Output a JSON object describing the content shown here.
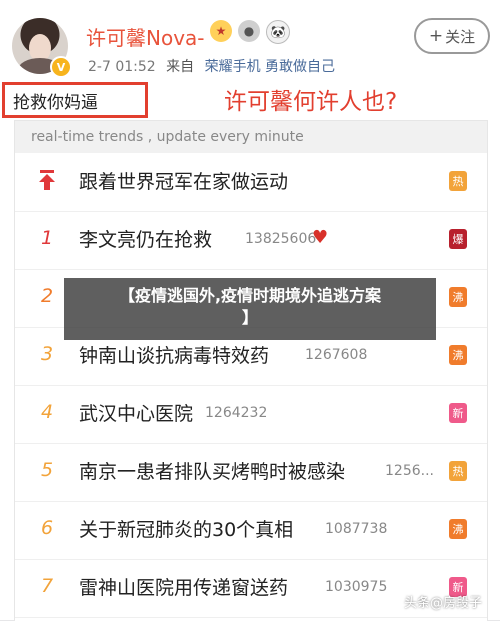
{
  "header": {
    "username": "许可馨Nova-",
    "verified_badge": "V",
    "badges": [
      {
        "icon": "medal-icon",
        "glyph": "★"
      },
      {
        "icon": "silver-medal-icon",
        "glyph": "●"
      },
      {
        "icon": "panda-icon",
        "glyph": "🐼"
      }
    ],
    "timestamp": "2-7 01:52",
    "from_label": "来自",
    "device": "荣耀手机 勇敢做自己",
    "follow_label": "关注",
    "follow_plus": "+"
  },
  "post": {
    "boxed_text": "抢救你妈逼",
    "headline": "许可馨何许人也?"
  },
  "trends": {
    "header": "real-time trends , update every minute",
    "items": [
      {
        "rank": "",
        "rank_icon": "pin-up-icon",
        "title": "跟着世界冠军在家做运动",
        "count": "",
        "tag": "热",
        "tag_color": "#f2a33a"
      },
      {
        "rank": "1",
        "rank_color": "#e0383a",
        "title": "李文亮仍在抢救",
        "count": "13825606",
        "heart": "♥",
        "tag": "爆",
        "tag_color": "#b8202d"
      },
      {
        "rank": "2",
        "rank_color": "#f07c2c",
        "title": "",
        "count": "",
        "tag": "沸",
        "tag_color": "#f07c2c"
      },
      {
        "rank": "3",
        "rank_color": "#f2a33a",
        "title": "钟南山谈抗病毒特效药",
        "count": "1267608",
        "tag": "沸",
        "tag_color": "#f07c2c"
      },
      {
        "rank": "4",
        "rank_color": "#f2a33a",
        "title": "武汉中心医院",
        "count": "1264232",
        "tag": "新",
        "tag_color": "#ef5a8a"
      },
      {
        "rank": "5",
        "rank_color": "#f2a33a",
        "title": "南京一患者排队买烤鸭时被感染",
        "count": "1256...",
        "tag": "热",
        "tag_color": "#f2a33a"
      },
      {
        "rank": "6",
        "rank_color": "#f2a33a",
        "title": "关于新冠肺炎的30个真相",
        "count": "1087738",
        "tag": "沸",
        "tag_color": "#f07c2c"
      },
      {
        "rank": "7",
        "rank_color": "#f2a33a",
        "title": "雷神山医院用传递窗送药",
        "count": "1030975",
        "tag": "新",
        "tag_color": "#ef5a8a"
      }
    ]
  },
  "overlay": {
    "line1": "【疫情逃国外,疫情时期境外追逃方案",
    "line2": "】"
  },
  "watermark": "头条@房段子"
}
